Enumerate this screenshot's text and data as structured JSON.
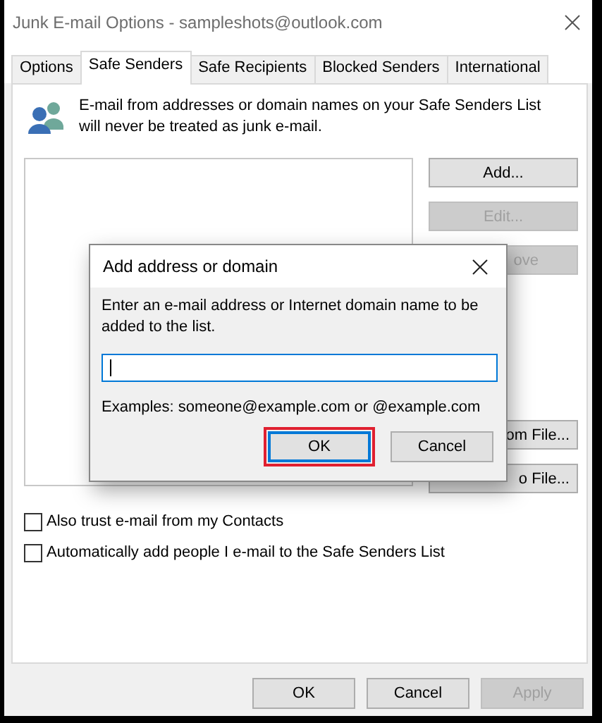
{
  "window": {
    "title": "Junk E-mail Options - sampleshots@outlook.com"
  },
  "tabs": [
    {
      "label": "Options",
      "selected": false
    },
    {
      "label": "Safe Senders",
      "selected": true
    },
    {
      "label": "Safe Recipients",
      "selected": false
    },
    {
      "label": "Blocked Senders",
      "selected": false
    },
    {
      "label": "International",
      "selected": false
    }
  ],
  "intro": "E-mail from addresses or domain names on your Safe Senders List will never be treated as junk e-mail.",
  "side_buttons": [
    {
      "label": "Add...",
      "disabled": false
    },
    {
      "label": "Edit...",
      "disabled": true
    },
    {
      "label": "ove",
      "disabled": true
    },
    {
      "label": "om File...",
      "disabled": false
    },
    {
      "label": "o File...",
      "disabled": false
    }
  ],
  "checkboxes": [
    {
      "label": "Also trust e-mail from my Contacts",
      "checked": false
    },
    {
      "label": "Automatically add people I e-mail to the Safe Senders List",
      "checked": false
    }
  ],
  "footer_buttons": [
    {
      "label": "OK",
      "disabled": false
    },
    {
      "label": "Cancel",
      "disabled": false
    },
    {
      "label": "Apply",
      "disabled": true
    }
  ],
  "dialog": {
    "title": "Add address or domain",
    "prompt": "Enter an e-mail address or Internet domain name to be added to the list.",
    "examples": "Examples: someone@example.com or @example.com",
    "buttons": [
      {
        "label": "OK",
        "focused": true,
        "highlighted": true
      },
      {
        "label": "Cancel",
        "focused": false,
        "highlighted": false
      }
    ]
  }
}
